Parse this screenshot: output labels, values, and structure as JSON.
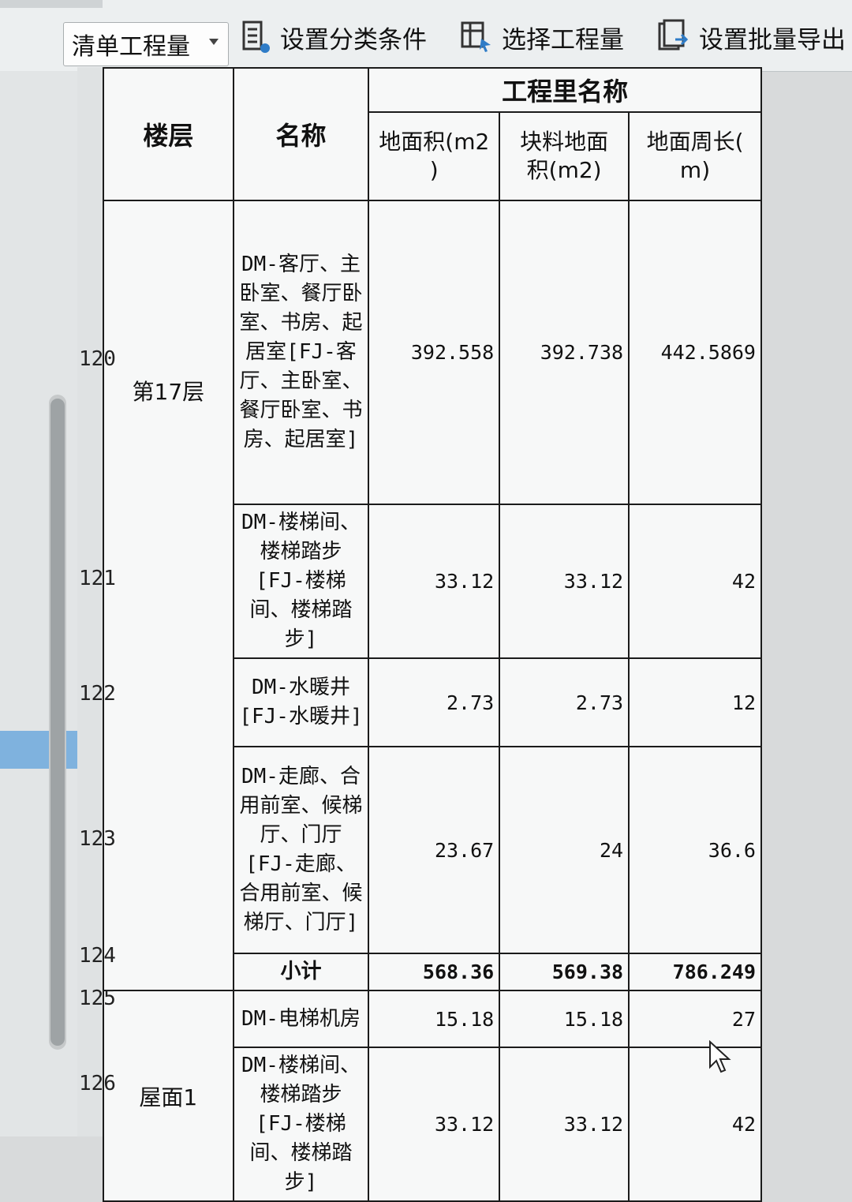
{
  "toolbar": {
    "dropdown_value": "清单工程量",
    "btn_category": "设置分类条件",
    "btn_select": "选择工程量",
    "btn_export": "设置批量导出"
  },
  "table": {
    "header_group": "工程里名称",
    "col_floor": "楼层",
    "col_name": "名称",
    "col_area": "地面积(m2\n)",
    "col_block": "块料地面\n积(m2)",
    "col_perim": "地面周长(\nm)"
  },
  "rows": [
    {
      "num": "120",
      "name": "DM-客厅、主卧室、餐厅卧室、书房、起居室[FJ-客厅、主卧室、餐厅卧室、书房、起居室]",
      "area": "392.558",
      "block": "392.738",
      "perim": "442.5869"
    },
    {
      "num": "121",
      "name": "DM-楼梯间、楼梯踏步[FJ-楼梯间、楼梯踏步]",
      "area": "33.12",
      "block": "33.12",
      "perim": "42"
    },
    {
      "num": "122",
      "name": "DM-水暖井[FJ-水暖井]",
      "area": "2.73",
      "block": "2.73",
      "perim": "12"
    },
    {
      "num": "123",
      "name": "DM-走廊、合用前室、候梯厅、门厅[FJ-走廊、合用前室、候梯厅、门厅]",
      "area": "23.67",
      "block": "24",
      "perim": "36.6"
    },
    {
      "num": "124",
      "name": "小计",
      "area": "568.36",
      "block": "569.38",
      "perim": "786.249"
    },
    {
      "num": "125",
      "name": "DM-电梯机房",
      "area": "15.18",
      "block": "15.18",
      "perim": "27"
    },
    {
      "num": "126",
      "name": "DM-楼梯间、楼梯踏步[FJ-楼梯间、楼梯踏步]",
      "area": "33.12",
      "block": "33.12",
      "perim": "42"
    }
  ],
  "floors": {
    "f17": "第17层",
    "roof": "屋面1"
  }
}
